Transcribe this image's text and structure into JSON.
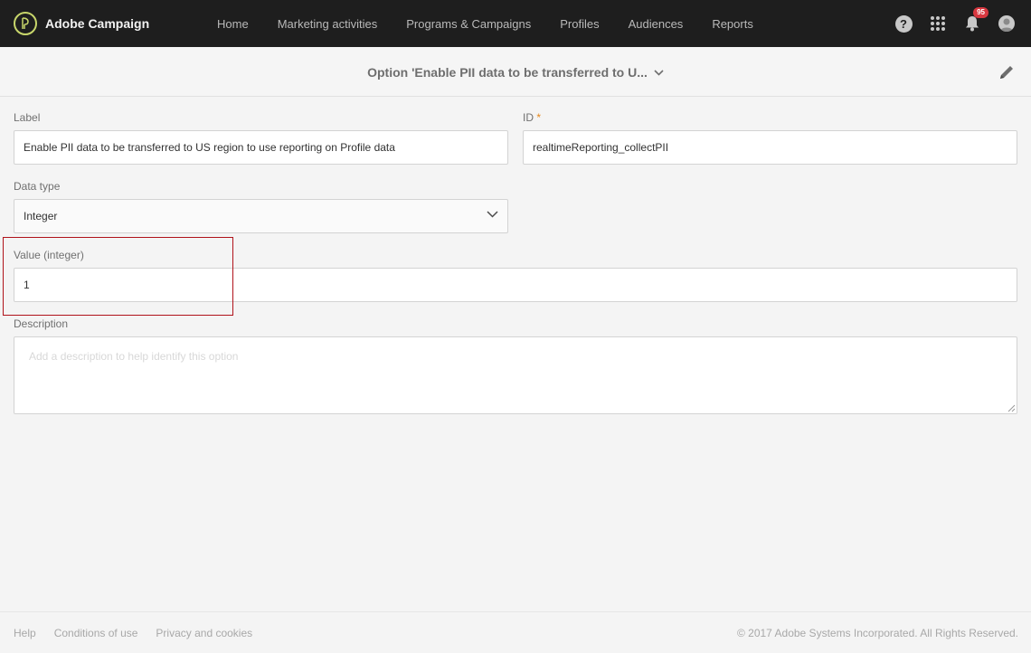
{
  "app": {
    "name": "Adobe Campaign",
    "logo_icon": "adobe-campaign-logo-icon",
    "brand_color": "#c8d66b"
  },
  "nav": {
    "items": [
      {
        "label": "Home"
      },
      {
        "label": "Marketing activities"
      },
      {
        "label": "Programs & Campaigns"
      },
      {
        "label": "Profiles"
      },
      {
        "label": "Audiences"
      },
      {
        "label": "Reports"
      }
    ]
  },
  "header_icons": {
    "help": "?",
    "notifications_count": "95",
    "badge_color": "#d7373f"
  },
  "page": {
    "title": "Option 'Enable PII data to be transferred to U...",
    "edit_icon": "pencil-icon"
  },
  "form": {
    "label": {
      "label": "Label",
      "value": "Enable PII data to be transferred to US region to use reporting on Profile data"
    },
    "id": {
      "label": "ID",
      "required_marker": "*",
      "value": "realtimeReporting_collectPII"
    },
    "data_type": {
      "label": "Data type",
      "value": "Integer"
    },
    "value": {
      "label": "Value (integer)",
      "value": "1"
    },
    "description": {
      "label": "Description",
      "placeholder": "Add a description to help identify this option"
    },
    "highlight_color": "#b0121a"
  },
  "footer": {
    "links": [
      {
        "label": "Help"
      },
      {
        "label": "Conditions of use"
      },
      {
        "label": "Privacy and cookies"
      }
    ],
    "copyright": "© 2017 Adobe Systems Incorporated. All Rights Reserved."
  }
}
